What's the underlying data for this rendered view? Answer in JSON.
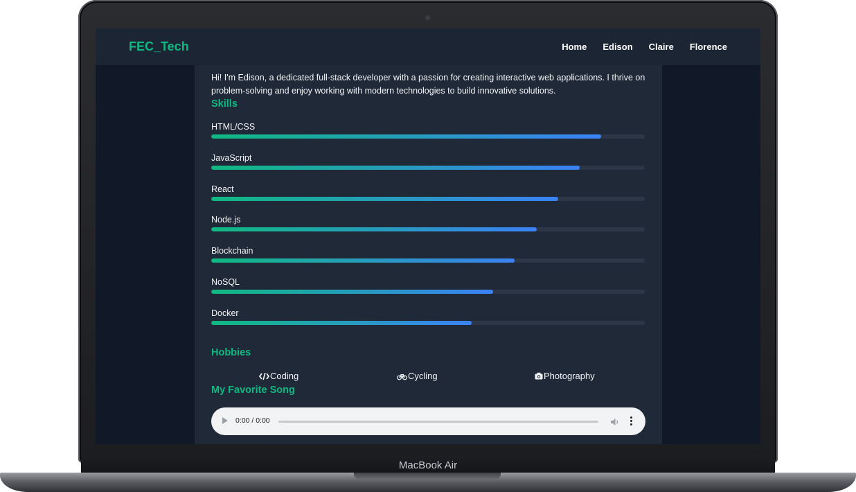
{
  "device": {
    "label": "MacBook Air"
  },
  "navbar": {
    "brand": "FEC_Tech",
    "links": [
      "Home",
      "Edison",
      "Claire",
      "Florence"
    ]
  },
  "profile": {
    "bio": "Hi! I'm Edison, a dedicated full-stack developer with a passion for creating interactive web applications. I thrive on problem-solving and enjoy working with modern technologies to build innovative solutions.",
    "skills_title": "Skills",
    "skills": [
      {
        "name": "HTML/CSS",
        "level": 0.9
      },
      {
        "name": "JavaScript",
        "level": 0.85
      },
      {
        "name": "React",
        "level": 0.8
      },
      {
        "name": "Node.js",
        "level": 0.75
      },
      {
        "name": "Blockchain",
        "level": 0.7
      },
      {
        "name": "NoSQL",
        "level": 0.65
      },
      {
        "name": "Docker",
        "level": 0.6
      }
    ],
    "hobbies_title": "Hobbies",
    "hobbies": [
      {
        "label": "Coding",
        "icon": "code-icon"
      },
      {
        "label": "Cycling",
        "icon": "bicycle-icon"
      },
      {
        "label": "Photography",
        "icon": "camera-icon"
      }
    ],
    "song_title": "My Favorite Song",
    "audio": {
      "time": "0:00 / 0:00"
    }
  },
  "colors": {
    "accent": "#10b981",
    "bar_end": "#3b82f6",
    "page_bg": "#111827",
    "card_bg": "#1f2937"
  }
}
